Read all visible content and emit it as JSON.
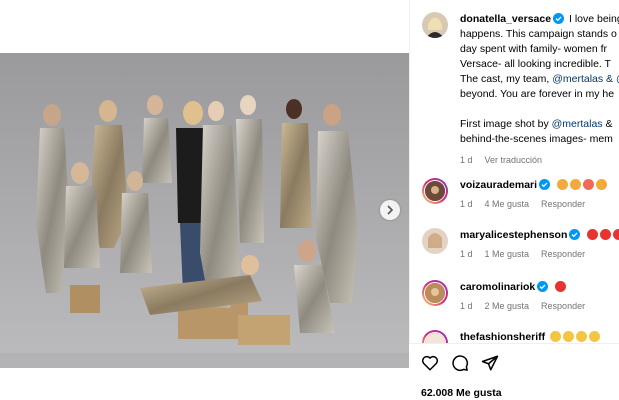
{
  "post": {
    "username": "donatella_versace",
    "caption_lines": [
      "I love being",
      "happens. This campaign stands o",
      "day spent with family- women fr",
      "Versace- all looking incredible. T",
      "The cast, my team, "
    ],
    "caption_line5_mention1": "@mertalas",
    "caption_line5_mention2": " & @",
    "caption_line6": "beyond. You are forever in my he",
    "caption_line8_pre": "First image shot by ",
    "caption_line8_mention": "@mertalas",
    "caption_line8_post": " &",
    "caption_line9": "behind-the-scenes images- mem",
    "time": "1 d",
    "translate": "Ver traducción"
  },
  "comments": [
    {
      "username": "voizaurademari",
      "verified": true,
      "time": "1 d",
      "likes": "4 Me gusta",
      "reply": "Responder",
      "emojis": [
        "#f4a93c",
        "#f4a93c",
        "#f06a5a",
        "#f4a93c"
      ]
    },
    {
      "username": "maryalicestephenson",
      "verified": true,
      "time": "1 d",
      "likes": "1 Me gusta",
      "reply": "Responder",
      "emojis": [
        "#e8342f",
        "#e8342f",
        "#e8342f"
      ]
    },
    {
      "username": "caromolinariok",
      "verified": true,
      "time": "1 d",
      "likes": "2 Me gusta",
      "reply": "Responder",
      "emojis": [
        "#e8342f"
      ]
    },
    {
      "username": "thefashionsheriff",
      "verified": false,
      "time": "",
      "likes": "",
      "reply": "",
      "emojis": [
        "#f4c542",
        "#f4c542",
        "#f4c542",
        "#f4c542"
      ]
    }
  ],
  "actions": {
    "like": "heart-icon",
    "comment": "comment-icon",
    "share": "share-icon"
  },
  "likes_count": "62.008 Me gusta",
  "colors": {
    "link": "#00376b",
    "muted": "#737373",
    "verified": "#0095f6"
  }
}
